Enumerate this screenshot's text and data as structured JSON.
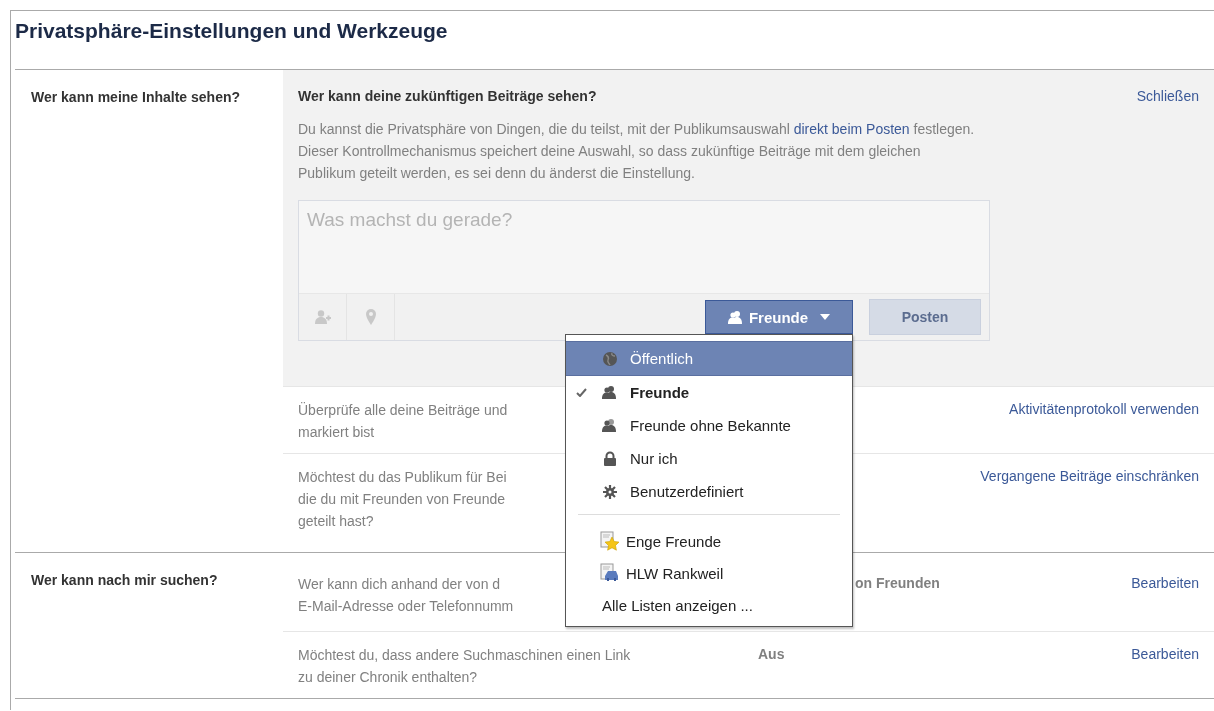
{
  "page": {
    "title": "Privatsphäre-Einstellungen und Werkzeuge"
  },
  "sections": [
    {
      "label": "Wer kann meine Inhalte sehen?",
      "panel": {
        "heading": "Wer kann deine zukünftigen Beiträge sehen?",
        "close": "Schließen",
        "description": {
          "before": "Du kannst die Privatsphäre von Dingen, die du teilst, mit der Publikumsauswahl ",
          "link": "direkt beim Posten",
          "after": " festlegen. Dieser Kontrollmechanismus speichert deine Auswahl, so dass zukünftige Beiträge mit dem gleichen Publikum geteilt werden, es sei denn du änderst die Einstellung."
        },
        "composer": {
          "placeholder": "Was machst du gerade?",
          "audience": "Freunde",
          "post": "Posten",
          "post_disabled": true
        }
      },
      "rows": [
        {
          "text": "Überprüfe alle deine Beiträge und\nmarkiert bist",
          "action": "Aktivitätenprotokoll verwenden"
        },
        {
          "text": "Möchtest du das Publikum für Bei\ndie du mit Freunden von Freunde\ngeteilt hast?",
          "action": "Vergangene Beiträge einschränken"
        }
      ]
    },
    {
      "label": "Wer kann nach mir suchen?",
      "rows": [
        {
          "text": "Wer kann dich anhand der von d\nE-Mail-Adresse oder Telefonnumm",
          "value": "on Freunden",
          "action": "Bearbeiten"
        },
        {
          "text": "Möchtest du, dass andere Suchmaschinen einen Link\nzu deiner Chronik enthalten?",
          "value": "Aus",
          "action": "Bearbeiten"
        }
      ]
    }
  ],
  "audience_menu": {
    "items": [
      {
        "kind": "audience",
        "label": "Öffentlich",
        "highlighted": true,
        "selected": false
      },
      {
        "kind": "audience",
        "label": "Freunde",
        "highlighted": false,
        "selected": true
      },
      {
        "kind": "audience",
        "label": "Freunde ohne Bekannte",
        "highlighted": false,
        "selected": false
      },
      {
        "kind": "audience",
        "label": "Nur ich",
        "highlighted": false,
        "selected": false
      },
      {
        "kind": "audience",
        "label": "Benutzerdefiniert",
        "highlighted": false,
        "selected": false
      },
      {
        "kind": "list",
        "label": "Enge Freunde",
        "highlighted": false,
        "selected": false
      },
      {
        "kind": "list",
        "label": "HLW Rankweil",
        "highlighted": false,
        "selected": false
      },
      {
        "kind": "link",
        "label": "Alle Listen anzeigen ...",
        "highlighted": false,
        "selected": false
      }
    ]
  }
}
